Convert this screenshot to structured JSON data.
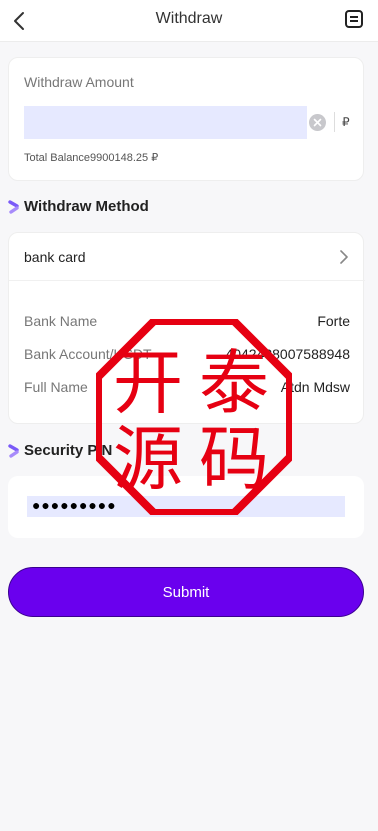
{
  "header": {
    "title": "Withdraw"
  },
  "amount": {
    "label": "Withdraw Amount",
    "value": "",
    "currency": "₽",
    "balance": "Total Balance9900148.25 ₽"
  },
  "method": {
    "section_title": "Withdraw Method",
    "selected": "bank card",
    "rows": [
      {
        "key": "Bank Name",
        "value": "Forte"
      },
      {
        "key": "Bank Account/USDT",
        "value": "4042438007588948"
      },
      {
        "key": "Full Name",
        "value": "Atdn Mdsw"
      }
    ]
  },
  "pin": {
    "section_title": "Security PIN",
    "value": "●●●●●●●●●"
  },
  "submit": {
    "label": "Submit"
  },
  "stamp": {
    "text": [
      "开",
      "泰",
      "源",
      "码"
    ],
    "color": "#e60012"
  },
  "colors": {
    "accent": "#6a00ee",
    "input_bg": "#e6e9ff"
  }
}
